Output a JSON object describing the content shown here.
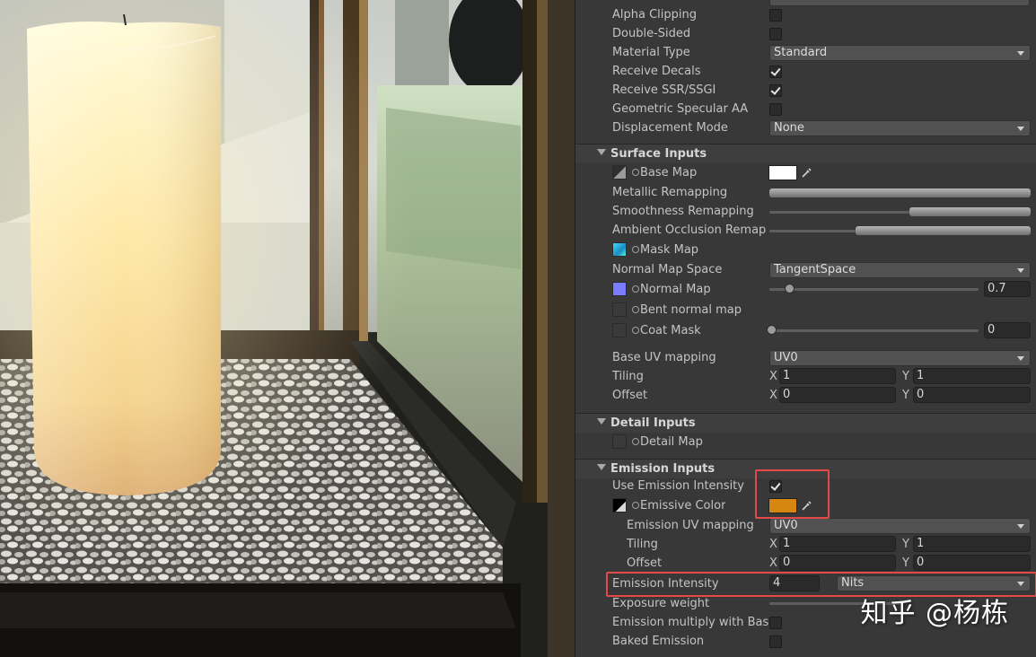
{
  "viewport": {
    "description_icon": "candle-lantern-render"
  },
  "inspector": {
    "top_rows": [
      {
        "label": "Alpha Clipping",
        "control": "checkbox",
        "checked": false
      },
      {
        "label": "Double-Sided",
        "control": "checkbox",
        "checked": false
      },
      {
        "label": "Material Type",
        "control": "dropdown",
        "value": "Standard"
      },
      {
        "label": "Receive Decals",
        "control": "checkbox",
        "checked": true
      },
      {
        "label": "Receive SSR/SSGI",
        "control": "checkbox",
        "checked": true
      },
      {
        "label": "Geometric Specular AA",
        "control": "checkbox",
        "checked": false
      },
      {
        "label": "Displacement Mode",
        "control": "dropdown",
        "value": "None"
      }
    ],
    "surface": {
      "title": "Surface Inputs",
      "base_map": "Base Map",
      "metallic_remapping": "Metallic Remapping",
      "smoothness_remapping": "Smoothness Remapping",
      "ao_remapping": "Ambient Occlusion Remappi",
      "mask_map": "Mask Map",
      "normal_map_space": "Normal Map Space",
      "normal_map_space_value": "TangentSpace",
      "normal_map": "Normal Map",
      "normal_map_value": "0.7",
      "bent_normal_map": "Bent normal map",
      "coat_mask": "Coat Mask",
      "coat_mask_value": "0",
      "base_uv_mapping": "Base UV mapping",
      "base_uv_value": "UV0",
      "tiling": "Tiling",
      "offset": "Offset",
      "x": "X",
      "y": "Y",
      "tiling_x": "1",
      "tiling_y": "1",
      "offset_x": "0",
      "offset_y": "0"
    },
    "detail": {
      "title": "Detail Inputs",
      "detail_map": "Detail Map"
    },
    "emission": {
      "title": "Emission Inputs",
      "use_intensity": "Use Emission Intensity",
      "use_intensity_checked": true,
      "emissive_color": "Emissive Color",
      "emissive_color_hex": "#d4860e",
      "uv_mapping": "Emission UV mapping",
      "uv_mapping_value": "UV0",
      "tiling": "Tiling",
      "offset": "Offset",
      "tiling_x": "1",
      "tiling_y": "1",
      "offset_x": "0",
      "offset_y": "0",
      "intensity": "Emission Intensity",
      "intensity_value": "4",
      "intensity_unit": "Nits",
      "exposure_weight": "Exposure weight",
      "multiply_base": "Emission multiply with Base",
      "baked": "Baked Emission"
    },
    "highlight_color": "#e24a4a"
  },
  "watermark": "知乎 @杨栋"
}
